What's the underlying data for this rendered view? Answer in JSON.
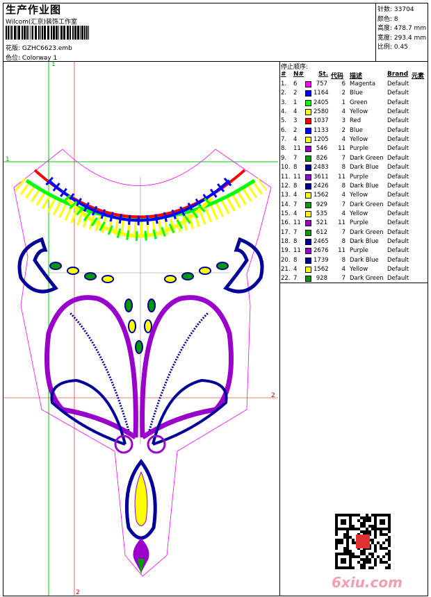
{
  "header": {
    "title": "生产作业图",
    "company": "Wilcom(汇京)装饰工作室",
    "design_label": "花版:",
    "design_file": "GZHC6623.emb",
    "colorway_label": "色位:",
    "colorway": "Colorway 1"
  },
  "stats": [
    {
      "label": "针数:",
      "value": "33704"
    },
    {
      "label": "颜色:",
      "value": "8"
    },
    {
      "label": "高度:",
      "value": "478.7 mm"
    },
    {
      "label": "宽度:",
      "value": "293.4 mm"
    },
    {
      "label": "比例:",
      "value": "0.45"
    }
  ],
  "stop_sequence": {
    "title": "停止顺序:",
    "columns": [
      "#",
      "N#",
      "St.",
      "代码",
      "描述",
      "Brand",
      "元素"
    ],
    "rows": [
      {
        "n": "1.",
        "needle": "6",
        "color": "#ff00ff",
        "st": "757",
        "code": "6",
        "desc": "Magenta",
        "brand": "Default"
      },
      {
        "n": "2.",
        "needle": "2",
        "color": "#0000ff",
        "st": "1164",
        "code": "2",
        "desc": "Blue",
        "brand": "Default"
      },
      {
        "n": "3.",
        "needle": "1",
        "color": "#00ff00",
        "st": "2405",
        "code": "1",
        "desc": "Green",
        "brand": "Default"
      },
      {
        "n": "4.",
        "needle": "4",
        "color": "#ffff00",
        "st": "2580",
        "code": "4",
        "desc": "Yellow",
        "brand": "Default"
      },
      {
        "n": "5.",
        "needle": "3",
        "color": "#ff0000",
        "st": "1037",
        "code": "3",
        "desc": "Red",
        "brand": "Default"
      },
      {
        "n": "6.",
        "needle": "2",
        "color": "#0000ff",
        "st": "1133",
        "code": "2",
        "desc": "Blue",
        "brand": "Default"
      },
      {
        "n": "7.",
        "needle": "4",
        "color": "#ffff00",
        "st": "1205",
        "code": "4",
        "desc": "Yellow",
        "brand": "Default"
      },
      {
        "n": "8.",
        "needle": "11",
        "color": "#9900cc",
        "st": "546",
        "code": "11",
        "desc": "Purple",
        "brand": "Default"
      },
      {
        "n": "9.",
        "needle": "7",
        "color": "#009900",
        "st": "826",
        "code": "7",
        "desc": "Dark Green",
        "brand": "Default"
      },
      {
        "n": "10.",
        "needle": "8",
        "color": "#000099",
        "st": "2483",
        "code": "8",
        "desc": "Dark Blue",
        "brand": "Default"
      },
      {
        "n": "11.",
        "needle": "11",
        "color": "#9900cc",
        "st": "3611",
        "code": "11",
        "desc": "Purple",
        "brand": "Default"
      },
      {
        "n": "12.",
        "needle": "8",
        "color": "#000099",
        "st": "2426",
        "code": "8",
        "desc": "Dark Blue",
        "brand": "Default"
      },
      {
        "n": "13.",
        "needle": "4",
        "color": "#ffff00",
        "st": "1562",
        "code": "4",
        "desc": "Yellow",
        "brand": "Default"
      },
      {
        "n": "14.",
        "needle": "7",
        "color": "#009900",
        "st": "929",
        "code": "7",
        "desc": "Dark Green",
        "brand": "Default"
      },
      {
        "n": "15.",
        "needle": "4",
        "color": "#ffff00",
        "st": "535",
        "code": "4",
        "desc": "Yellow",
        "brand": "Default"
      },
      {
        "n": "16.",
        "needle": "11",
        "color": "#9900cc",
        "st": "521",
        "code": "11",
        "desc": "Purple",
        "brand": "Default"
      },
      {
        "n": "17.",
        "needle": "7",
        "color": "#009900",
        "st": "612",
        "code": "7",
        "desc": "Dark Green",
        "brand": "Default"
      },
      {
        "n": "18.",
        "needle": "8",
        "color": "#000099",
        "st": "2465",
        "code": "8",
        "desc": "Dark Blue",
        "brand": "Default"
      },
      {
        "n": "19.",
        "needle": "11",
        "color": "#9900cc",
        "st": "2676",
        "code": "11",
        "desc": "Purple",
        "brand": "Default"
      },
      {
        "n": "20.",
        "needle": "8",
        "color": "#000099",
        "st": "1739",
        "code": "8",
        "desc": "Dark Blue",
        "brand": "Default"
      },
      {
        "n": "21.",
        "needle": "4",
        "color": "#ffff00",
        "st": "1562",
        "code": "4",
        "desc": "Yellow",
        "brand": "Default"
      },
      {
        "n": "22.",
        "needle": "7",
        "color": "#009900",
        "st": "928",
        "code": "7",
        "desc": "Dark Green",
        "brand": "Default"
      }
    ]
  },
  "guides": {
    "green_label": "1",
    "red_label": "2"
  },
  "watermark": "6xiu.com"
}
